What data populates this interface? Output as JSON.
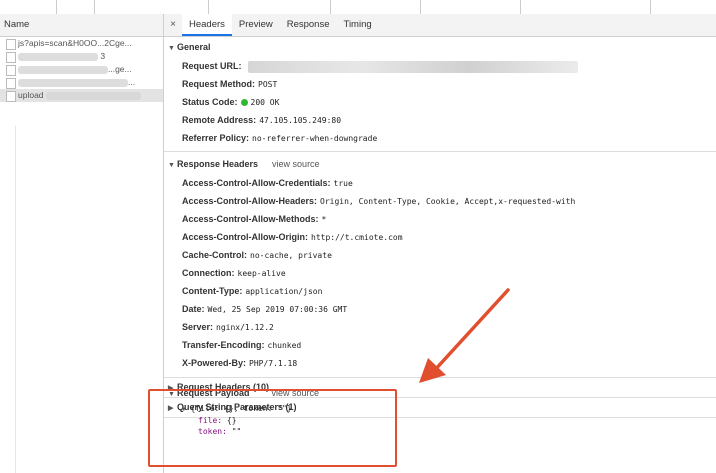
{
  "left_panel": {
    "header": "Name",
    "rows": [
      {
        "text": "js?apis=scan&H0OO...2Cge...",
        "selected": false
      },
      {
        "text": "3",
        "selected": false
      },
      {
        "text": "...ge...",
        "selected": false
      },
      {
        "text": "...",
        "selected": false
      },
      {
        "text": "upload",
        "selected": true
      }
    ]
  },
  "tabs": {
    "close": "×",
    "items": [
      "Headers",
      "Preview",
      "Response",
      "Timing"
    ]
  },
  "general": {
    "title": "General",
    "request_url_label": "Request URL:",
    "request_method_label": "Request Method:",
    "request_method": "POST",
    "status_code_label": "Status Code:",
    "status_code": "200 OK",
    "remote_address_label": "Remote Address:",
    "remote_address": "47.105.105.249:80",
    "referrer_policy_label": "Referrer Policy:",
    "referrer_policy": "no-referrer-when-downgrade"
  },
  "response_headers": {
    "title": "Response Headers",
    "view_source": "view source",
    "items": [
      {
        "k": "Access-Control-Allow-Credentials:",
        "v": "true"
      },
      {
        "k": "Access-Control-Allow-Headers:",
        "v": "Origin, Content-Type, Cookie, Accept,x-requested-with"
      },
      {
        "k": "Access-Control-Allow-Methods:",
        "v": "*"
      },
      {
        "k": "Access-Control-Allow-Origin:",
        "v": "http://t.cmiote.com"
      },
      {
        "k": "Cache-Control:",
        "v": "no-cache, private"
      },
      {
        "k": "Connection:",
        "v": "keep-alive"
      },
      {
        "k": "Content-Type:",
        "v": "application/json"
      },
      {
        "k": "Date:",
        "v": "Wed, 25 Sep 2019 07:00:36 GMT"
      },
      {
        "k": "Server:",
        "v": "nginx/1.12.2"
      },
      {
        "k": "Transfer-Encoding:",
        "v": "chunked"
      },
      {
        "k": "X-Powered-By:",
        "v": "PHP/7.1.18"
      }
    ]
  },
  "request_headers": {
    "title": "Request Headers (10)"
  },
  "query_string": {
    "title": "Query String Parameters (1)"
  },
  "payload": {
    "title": "Request Payload",
    "view_source": "view source",
    "root": "{file: {}, token: \"\"}",
    "file_key": "file:",
    "file_val": "{}",
    "token_key": "token:",
    "token_val": "\"\""
  },
  "colors": {
    "annotation": "#e14f2f",
    "status_ok": "#2fb82f",
    "tab_accent": "#1a73e8"
  }
}
